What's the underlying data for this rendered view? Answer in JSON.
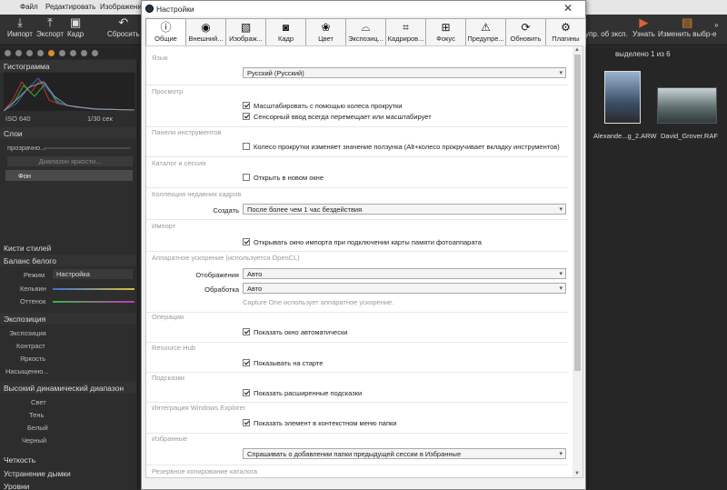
{
  "app": {
    "menu": [
      "Файл",
      "Редактировать",
      "Изображение"
    ],
    "toolbar": [
      "Импорт",
      "Экспорт",
      "Кадр",
      "Сбросить"
    ],
    "toolbar_right": [
      "упр. об эксп.",
      "Узнать",
      "Изменить выбр-е"
    ],
    "histogram_header": "Гистограмма",
    "iso": "ISO 640",
    "shutter": "1/30 сек",
    "layers_header": "Слои",
    "opacity_label": "прозрачно...",
    "brightness_range_btn": "Диапазон яркости...",
    "layer_name": "Фон",
    "panels": {
      "styles": "Кисти стилей",
      "white_balance": "Баланс белого",
      "wb_mode_label": "Режим",
      "wb_mode_value": "Настройка",
      "kelvin": "Кельвин",
      "tint": "Оттенок",
      "exposure": "Экспозиция",
      "exposure_sliders": [
        "Экспозиция",
        "Контраст",
        "Яркость",
        "Насыщенно..."
      ],
      "hdr": "Высокий динамический диапазон",
      "hdr_sliders": [
        "Свет",
        "Тень",
        "Белый",
        "Черный"
      ],
      "clarity": "Четкость",
      "dehaze": "Устранение дымки",
      "levels": "Уровни"
    },
    "browser": {
      "selected": "выделено 1 из 6",
      "files": [
        "Alexande...g_2.ARW",
        "David_Grover.RAF"
      ]
    }
  },
  "dialog": {
    "title": "Настройки",
    "tabs": [
      {
        "label": "Общие",
        "icon": "info-icon"
      },
      {
        "label": "Внешний...",
        "icon": "eye-icon"
      },
      {
        "label": "Изображ...",
        "icon": "image-icon"
      },
      {
        "label": "Кадр",
        "icon": "camera-icon"
      },
      {
        "label": "Цвет",
        "icon": "color-icon"
      },
      {
        "label": "Экспозиц...",
        "icon": "exposure-icon"
      },
      {
        "label": "Кадриров...",
        "icon": "crop-icon"
      },
      {
        "label": "Фокус",
        "icon": "focus-icon"
      },
      {
        "label": "Предупре...",
        "icon": "warning-icon"
      },
      {
        "label": "Обновить",
        "icon": "update-icon"
      },
      {
        "label": "Плагины",
        "icon": "plugins-icon"
      }
    ],
    "sections": {
      "language": {
        "title": "Язык",
        "value": "Русский (Русский)"
      },
      "view": {
        "title": "Просмотр",
        "scroll_zoom": "Масштабировать с помощью колеса прокрутки",
        "touch_pan": "Сенсорный ввод всегда перемещает или масштабирует"
      },
      "toolpanels": {
        "title": "Панели инструментов",
        "wheel": "Колесо прокрутки изменяет значение ползунка (Alt+колесо прокручивает вкладку инструментов)"
      },
      "catalog": {
        "title": "Каталог и сессия",
        "open_new": "Открыть в новом окне"
      },
      "recent": {
        "title": "Коллекция недавних кадров",
        "create_label": "Создать",
        "create_value": "После более чем 1 час бездействия"
      },
      "import": {
        "title": "Импорт",
        "open_import": "Открывать окно импорта при подключении карты памяти фотоаппарата"
      },
      "opencl": {
        "title": "Аппаратное ускорение (используется OpenCL)",
        "display_label": "Отображения",
        "display_value": "Авто",
        "processing_label": "Обработка",
        "processing_value": "Авто",
        "note": "Capture One использует аппаратное ускорение."
      },
      "operations": {
        "title": "Операции",
        "show_auto": "Показать окно автоматически"
      },
      "resource_hub": {
        "title": "Resource Hub",
        "show_start": "Показывать на старте"
      },
      "tooltips": {
        "title": "Подсказки",
        "extended": "Показать расширенные подсказки"
      },
      "explorer": {
        "title": "Интеграция Windows Explorer",
        "context_menu": "Показать элемент в контекстном меню папки"
      },
      "favorites": {
        "title": "Избранные",
        "value": "Спрашивать о добавлении папки предыдущей сессии в Избранные"
      },
      "backup": {
        "title": "Резервное копирование каталога"
      }
    }
  }
}
